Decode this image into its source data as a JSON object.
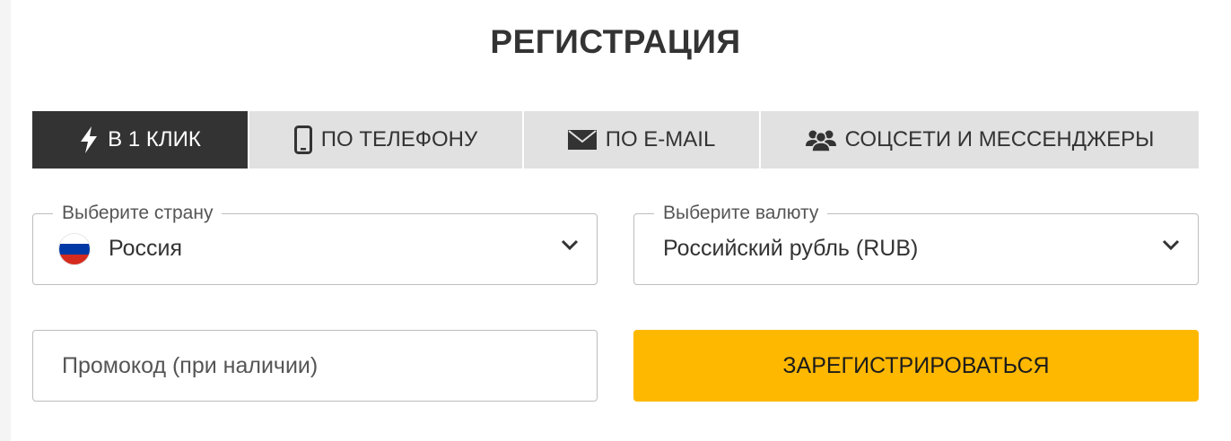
{
  "title": "РЕГИСТРАЦИЯ",
  "tabs": [
    {
      "label": "В 1 КЛИК",
      "icon": "lightning-icon",
      "active": true
    },
    {
      "label": "ПО ТЕЛЕФОНУ",
      "icon": "phone-icon",
      "active": false
    },
    {
      "label": "ПО E-MAIL",
      "icon": "envelope-icon",
      "active": false
    },
    {
      "label": "СОЦСЕТИ И МЕССЕНДЖЕРЫ",
      "icon": "users-icon",
      "active": false
    }
  ],
  "country": {
    "legend": "Выберите страну",
    "value": "Россия",
    "flag_colors": [
      "#ffffff",
      "#0039a6",
      "#d52b1e"
    ]
  },
  "currency": {
    "legend": "Выберите валюту",
    "value": "Российский рубль (RUB)"
  },
  "promo": {
    "placeholder": "Промокод (при наличии)"
  },
  "register_button": "ЗАРЕГИСТРИРОВАТЬСЯ",
  "colors": {
    "accent": "#ffb800",
    "tab_active": "#333333",
    "tab_inactive": "#e1e1e1"
  }
}
